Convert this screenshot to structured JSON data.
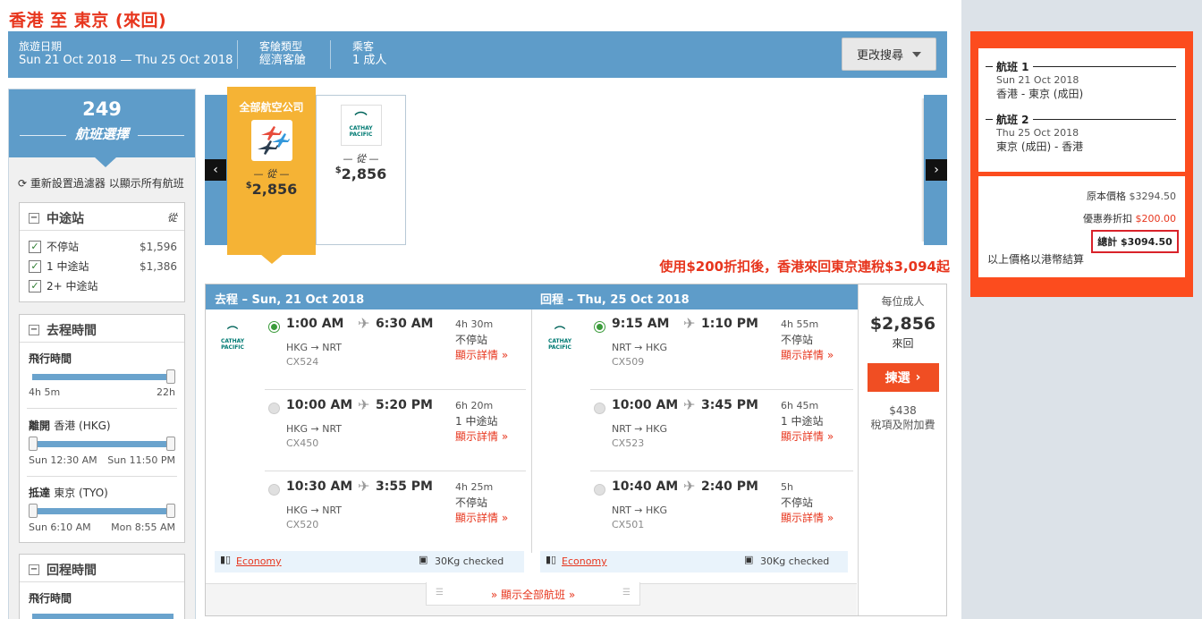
{
  "route_title": "香港 至 東京 (來回)",
  "search": {
    "dates_label": "旅遊日期",
    "dates_value": "Sun 21 Oct 2018 — Thu 25 Oct 2018",
    "cabin_label": "客艙類型",
    "cabin_value": "經濟客艙",
    "pax_label": "乘客",
    "pax_value": "1 成人",
    "modify_button": "更改搜尋"
  },
  "filters": {
    "count": "249",
    "count_label": "航班選擇",
    "reset_text": "重新設置過濾器 以顯示所有航班",
    "stops": {
      "title": "中途站",
      "from_label": "從",
      "items": [
        {
          "label": "不停站",
          "price": "$1,596",
          "checked": true
        },
        {
          "label": "1 中途站",
          "price": "$1,386",
          "checked": true
        },
        {
          "label": "2+ 中途站",
          "price": "",
          "checked": true
        }
      ]
    },
    "outbound": {
      "title": "去程時間",
      "duration_label": "飛行時間",
      "duration_min": "4h 5m",
      "duration_max": "22h",
      "depart_label": "離開",
      "depart_place": "香港 (HKG)",
      "depart_min": "Sun 12:30 AM",
      "depart_max": "Sun 11:50 PM",
      "arrive_label": "抵達",
      "arrive_place": "東京 (TYO)",
      "arrive_min": "Sun 6:10 AM",
      "arrive_max": "Mon 8:55 AM"
    },
    "return": {
      "title": "回程時間",
      "duration_label": "飛行時間"
    }
  },
  "carousel": {
    "all_label": "全部航空公司",
    "all_from": "從",
    "all_price_currency": "$",
    "all_price": "2,856",
    "airline_from": "從",
    "airline_price_currency": "$",
    "airline_price": "2,856",
    "airline_logo_text": "CATHAY PACIFIC"
  },
  "promo": "使用$200折扣後，香港來回東京連稅$3,094起",
  "results": {
    "outbound_header": "去程 – Sun, 21 Oct 2018",
    "return_header": "回程 – Thu, 25 Oct 2018",
    "logo_text": "CATHAY PACIFIC",
    "details_label": "顯示詳情",
    "outbound_options": [
      {
        "dep": "1:00 AM",
        "arr": "6:30 AM",
        "route": "HKG → NRT",
        "flight": "CX524",
        "duration": "4h 30m",
        "stops": "不停站",
        "selected": true
      },
      {
        "dep": "10:00 AM",
        "arr": "5:20 PM",
        "route": "HKG → NRT",
        "flight": "CX450",
        "duration": "6h 20m",
        "stops": "1 中途站",
        "selected": false
      },
      {
        "dep": "10:30 AM",
        "arr": "3:55 PM",
        "route": "HKG → NRT",
        "flight": "CX520",
        "duration": "4h 25m",
        "stops": "不停站",
        "selected": false
      }
    ],
    "return_options": [
      {
        "dep": "9:15 AM",
        "arr": "1:10 PM",
        "route": "NRT → HKG",
        "flight": "CX509",
        "duration": "4h 55m",
        "stops": "不停站",
        "selected": true
      },
      {
        "dep": "10:00 AM",
        "arr": "3:45 PM",
        "route": "NRT → HKG",
        "flight": "CX523",
        "duration": "6h 45m",
        "stops": "1 中途站",
        "selected": false
      },
      {
        "dep": "10:40 AM",
        "arr": "2:40 PM",
        "route": "NRT → HKG",
        "flight": "CX501",
        "duration": "5h",
        "stops": "不停站",
        "selected": false
      }
    ],
    "fare_class": "Economy",
    "baggage": "30Kg checked",
    "price_per_label": "每位成人",
    "price": "$2,856",
    "round_trip_label": "來回",
    "select_button": "揀選",
    "tax_amount": "$438",
    "tax_label": "稅項及附加費",
    "show_all_label": "顯示全部航班"
  },
  "summary": {
    "seg1_title": "航班 1",
    "seg1_date": "Sun 21 Oct 2018",
    "seg1_route": "香港 - 東京 (成田)",
    "seg2_title": "航班 2",
    "seg2_date": "Thu 25 Oct 2018",
    "seg2_route": "東京 (成田) - 香港",
    "original_label": "原本價格",
    "original_value": "$3294.50",
    "coupon_label": "優惠券折扣",
    "coupon_value": "$200.00",
    "total_label": "總計",
    "total_value": "$3094.50",
    "note": "以上價格以港幣結算"
  },
  "colors": {
    "brand_blue": "#5e9cc9",
    "accent_red": "#e7351d",
    "orange_btn": "#f04e23",
    "all_airlines_gold": "#f5b335",
    "summary_orange": "#fc4c1e"
  }
}
